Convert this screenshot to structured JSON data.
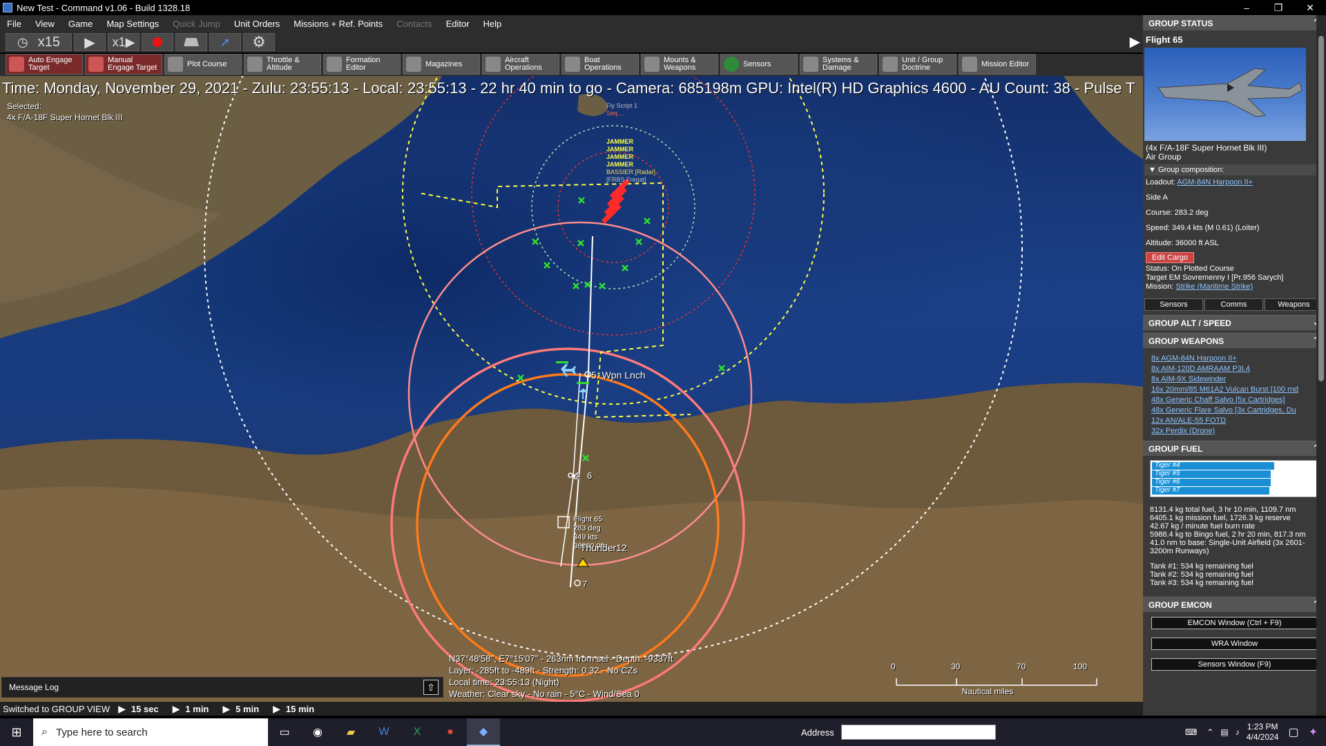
{
  "window": {
    "title": "New Test - Command v1.06 - Build 1328.18",
    "minimize": "–",
    "restore": "❐",
    "close": "✕"
  },
  "menu": [
    "File",
    "View",
    "Game",
    "Map Settings",
    "Quick Jump",
    "Unit Orders",
    "Missions + Ref. Points",
    "Contacts",
    "Editor",
    "Help"
  ],
  "time_controls": {
    "clock_icon": "clock-icon",
    "compression_a": "x15",
    "compression_b": "x1",
    "play": "▶",
    "expand": "▶"
  },
  "toolbar": [
    {
      "label": "Auto Engage Target",
      "icon": "auto-engage-icon",
      "red": true
    },
    {
      "label": "Manual Engage Target",
      "icon": "manual-engage-icon",
      "red": true
    },
    {
      "label": "Plot Course",
      "icon": "plot-course-icon",
      "red": false
    },
    {
      "label": "Throttle & Altitude",
      "icon": "throttle-icon",
      "red": false
    },
    {
      "label": "Formation Editor",
      "icon": "formation-icon",
      "red": false
    },
    {
      "label": "Magazines",
      "icon": "magazines-icon",
      "red": false
    },
    {
      "label": "Aircraft Operations",
      "icon": "aircraft-icon",
      "red": false
    },
    {
      "label": "Boat Operations",
      "icon": "boat-icon",
      "red": false
    },
    {
      "label": "Mounts & Weapons",
      "icon": "mounts-icon",
      "red": false
    },
    {
      "label": "Sensors",
      "icon": "sensors-icon",
      "red": false
    },
    {
      "label": "Systems & Damage",
      "icon": "systems-icon",
      "red": false
    },
    {
      "label": "Unit / Group Doctrine",
      "icon": "doctrine-icon",
      "red": false
    },
    {
      "label": "Mission Editor",
      "icon": "mission-editor-icon",
      "red": false
    }
  ],
  "map": {
    "infoline": "Time: Monday, November 29, 2021 - Zulu: 23:55:13 - Local: 23:55:13 - 22 hr 40 min to go -  Camera: 685198m  GPU: Intel(R) HD Graphics 4600 - AU Count: 38 - Pulse T",
    "selected_label": "Selected:",
    "selected_unit": "4x F/A-18F Super Hornet Blk III",
    "wpn_lnch": "5: Wpn Lnch",
    "wp6": "6",
    "wp7": "7",
    "wp4": "4",
    "flight_label": [
      "Flight 65",
      "283 deg",
      "349 kts",
      "36000.0ft"
    ],
    "thunder": "Thunder12",
    "contact_labels": [
      "Fly Script 1",
      "Seq ...",
      "JAMMER",
      "JAMMER",
      "JAMMER",
      "JAMMER",
      "BASSIER [Radar]",
      "[FRBS Fregat]"
    ],
    "coord_lines": [
      "N37°48'58\", E7°15'07\" - 263nm from sel - Depth: -9337ft",
      "Layer: -285ft to -489ft - Strength: 0.32 - No CZs",
      "Local time: 23:55:13 (Night)",
      "Weather: Clear sky - No rain - 5°C - Wind/Sea 0"
    ],
    "scale_ticks": [
      "0",
      "30",
      "70",
      "100"
    ],
    "scale_label": "Nautical miles"
  },
  "message_log": {
    "label": "Message Log",
    "up": "⇧"
  },
  "statusbar": {
    "view": "Switched to GROUP VIEW",
    "steps": [
      "15 sec",
      "1 min",
      "5 min",
      "15 min"
    ]
  },
  "panel": {
    "status_head": "GROUP STATUS",
    "flight_name": "Flight 65",
    "unit_link": "(4x F/A-18F Super Hornet Blk III)",
    "unit_type": "Air Group",
    "composition": "Group composition:",
    "loadout_label": "Loadout:",
    "loadout_value": "AGM-84N Harpoon II+",
    "side": "Side A",
    "course": "Course: 283.2 deg",
    "speed": "Speed: 349.4 kts (M 0.61) (Loiter)",
    "altitude": "Altitude: 36000 ft ASL",
    "edit_cargo": "Edit Cargo",
    "status": "Status: On Plotted Course",
    "target": "Target EM Sovremenny I [Pr.956 Sarych]",
    "mission_label": "Mission:",
    "mission_value": "Strike (Maritime Strike)",
    "tabs": [
      "Sensors",
      "Comms",
      "Weapons"
    ],
    "alt_head": "GROUP ALT / SPEED",
    "weapons_head": "GROUP WEAPONS",
    "weapons": [
      "8x AGM-84N Harpoon II+",
      "8x AIM-120D AMRAAM P3I.4",
      "8x AIM-9X Sidewinder",
      "16x 20mm/85 M61A2 Vulcan Burst [100 rnd",
      "48x Generic Chaff Salvo [5x Cartridges]",
      "48x Generic Flare Salvo [3x Cartridges, Du",
      "12x AN/ALE-55 FOTD",
      "32x Perdix (Drone)"
    ],
    "fuel_head": "GROUP FUEL",
    "fuel_bars": [
      {
        "name": "Tiger #4",
        "frac": 0.74
      },
      {
        "name": "Tiger #5",
        "frac": 0.72
      },
      {
        "name": "Tiger #6",
        "frac": 0.72
      },
      {
        "name": "Tiger #7",
        "frac": 0.71
      }
    ],
    "fuel_lines": [
      "8131.4 kg total fuel, 3 hr 10 min, 1109.7 nm",
      "6405.1 kg mission fuel, 1726.3 kg reserve",
      "42.67 kg / minute fuel burn rate",
      "5988.4 kg to Bingo fuel, 2 hr 20 min, 817.3 nm",
      "41.0 nm to base: Single-Unit Airfield (3x 2601-3200m Runways)",
      "",
      "Tank #1: 534 kg remaining fuel",
      "Tank #2: 534 kg remaining fuel",
      "Tank #3: 534 kg remaining fuel"
    ],
    "emcon_head": "GROUP EMCON",
    "emcon_btn": "EMCON Window (Ctrl + F9)",
    "wra_btn": "WRA Window",
    "sensors_btn": "Sensors Window (F9)"
  },
  "taskbar": {
    "search_placeholder": "Type here to search",
    "address_label": "Address",
    "time": "1:23 PM",
    "date": "4/4/2024"
  },
  "colors": {
    "accent_link": "#8ec5ff",
    "fuel_fill": "#1a8fd6",
    "edit_cargo": "#cc4444"
  }
}
